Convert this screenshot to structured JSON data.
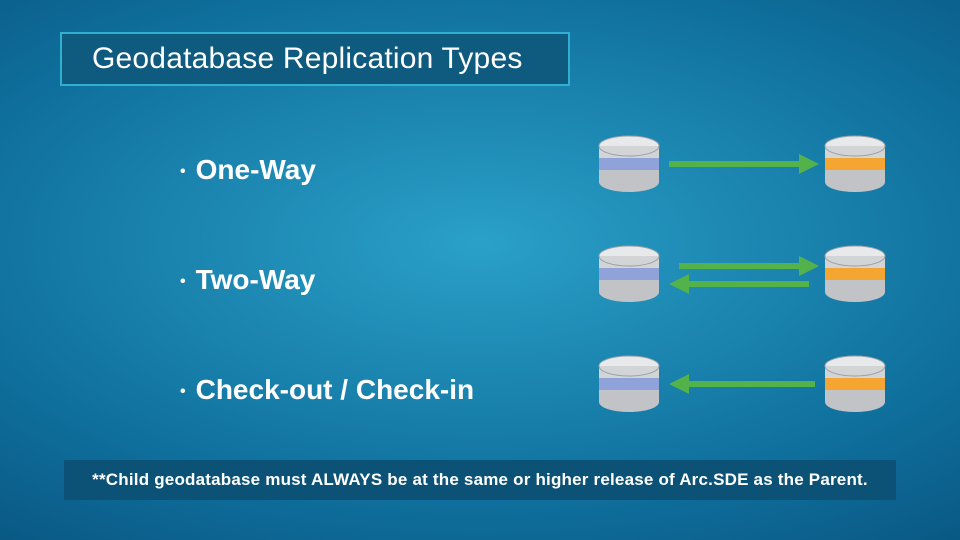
{
  "title": "Geodatabase Replication Types",
  "items": [
    {
      "label": "One-Way"
    },
    {
      "label": "Two-Way"
    },
    {
      "label": "Check-out / Check-in"
    }
  ],
  "note": "**Child geodatabase must ALWAYS be at the same or higher release of Arc.SDE as the Parent.",
  "icons": {
    "db_left_band": "#8fa3da",
    "db_right_band": "#f5a531",
    "db_top": "#e8e9ea",
    "db_mid": "#d2d4d6",
    "db_bot": "#c1c3c6",
    "arrow": "#54b24a"
  }
}
